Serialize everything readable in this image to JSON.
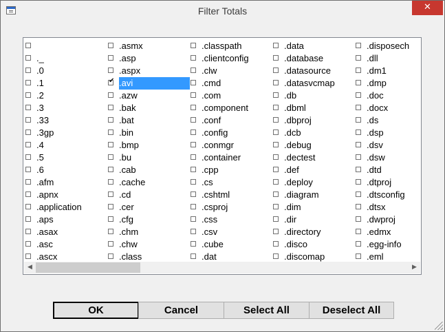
{
  "window": {
    "title": "Filter Totals",
    "close_glyph": "✕"
  },
  "list": {
    "columns": [
      [
        "",
        "._",
        ".0",
        ".1",
        ".2",
        ".3",
        ".33",
        ".3gp",
        ".4",
        ".5",
        ".6",
        ".afm",
        ".apnx",
        ".application",
        ".aps",
        ".asax",
        ".asc",
        ".ascx"
      ],
      [
        ".asmx",
        ".asp",
        ".aspx",
        ".avi",
        ".azw",
        ".bak",
        ".bat",
        ".bin",
        ".bmp",
        ".bu",
        ".cab",
        ".cache",
        ".cd",
        ".cer",
        ".cfg",
        ".chm",
        ".chw",
        ".class"
      ],
      [
        ".classpath",
        ".clientconfig",
        ".clw",
        ".cmd",
        ".com",
        ".component",
        ".conf",
        ".config",
        ".conmgr",
        ".container",
        ".cpp",
        ".cs",
        ".cshtml",
        ".csproj",
        ".css",
        ".csv",
        ".cube",
        ".dat"
      ],
      [
        ".data",
        ".database",
        ".datasource",
        ".datasvcmap",
        ".db",
        ".dbml",
        ".dbproj",
        ".dcb",
        ".debug",
        ".dectest",
        ".def",
        ".deploy",
        ".diagram",
        ".dim",
        ".dir",
        ".directory",
        ".disco",
        ".discomap"
      ],
      [
        ".disposech",
        ".dll",
        ".dm1",
        ".dmp",
        ".doc",
        ".docx",
        ".ds",
        ".dsp",
        ".dsv",
        ".dsw",
        ".dtd",
        ".dtproj",
        ".dtsconfig",
        ".dtsx",
        ".dwproj",
        ".edmx",
        ".egg-info",
        ".eml"
      ]
    ],
    "checked": [
      ".avi"
    ],
    "selected": ".avi"
  },
  "scrollbar": {
    "left_arrow": "◀",
    "right_arrow": "▶"
  },
  "buttons": {
    "ok": "OK",
    "cancel": "Cancel",
    "select_all": "Select All",
    "deselect_all": "Deselect All"
  }
}
